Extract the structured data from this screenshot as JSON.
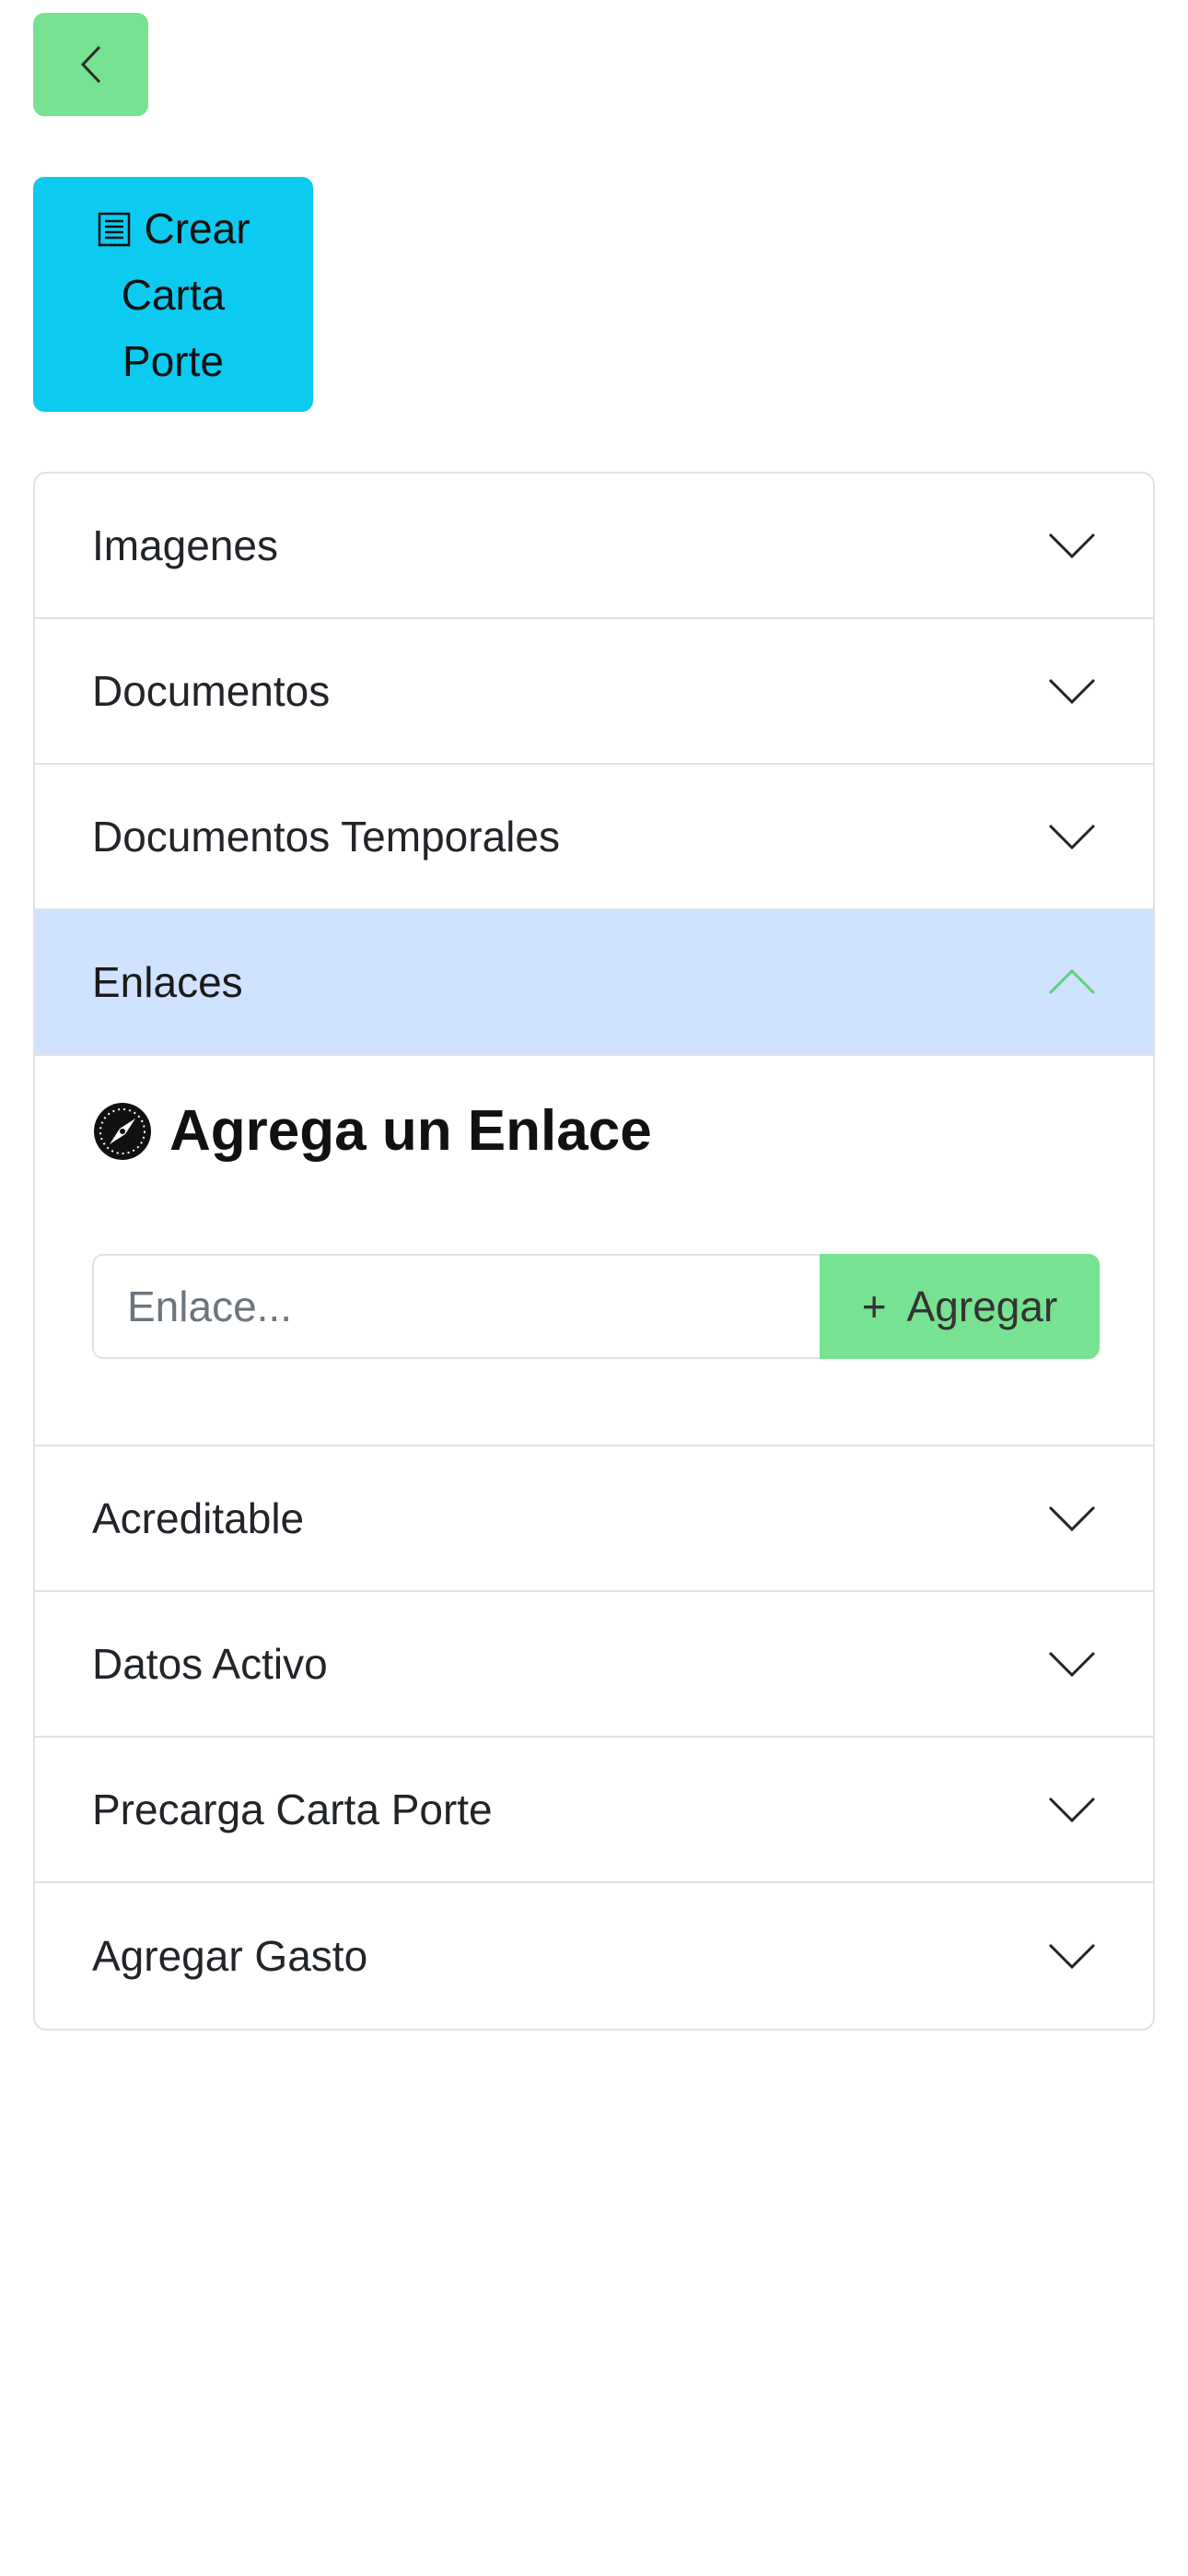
{
  "back_button": {
    "icon": "chevron-left-icon"
  },
  "crear_button": {
    "icon": "document-icon",
    "label_line1": "Crear",
    "label_line2": "Carta",
    "label_line3": "Porte"
  },
  "accordion": {
    "items": [
      {
        "label": "Imagenes",
        "expanded": false
      },
      {
        "label": "Documentos",
        "expanded": false
      },
      {
        "label": "Documentos Temporales",
        "expanded": false
      },
      {
        "label": "Enlaces",
        "expanded": true
      },
      {
        "label": "Acreditable",
        "expanded": false
      },
      {
        "label": "Datos Activo",
        "expanded": false
      },
      {
        "label": "Precarga Carta Porte",
        "expanded": false
      },
      {
        "label": "Agregar Gasto",
        "expanded": false
      }
    ]
  },
  "enlaces_panel": {
    "title": "Agrega un Enlace",
    "title_icon": "compass-icon",
    "input_placeholder": "Enlace...",
    "input_value": "",
    "add_button_label": "Agregar",
    "add_button_icon": "plus-icon"
  },
  "colors": {
    "green_button": "#77e291",
    "cyan_button": "#0dcaf0",
    "active_header": "#cfe2ff",
    "border": "#dee2e6",
    "active_chevron": "#5fd07f"
  }
}
